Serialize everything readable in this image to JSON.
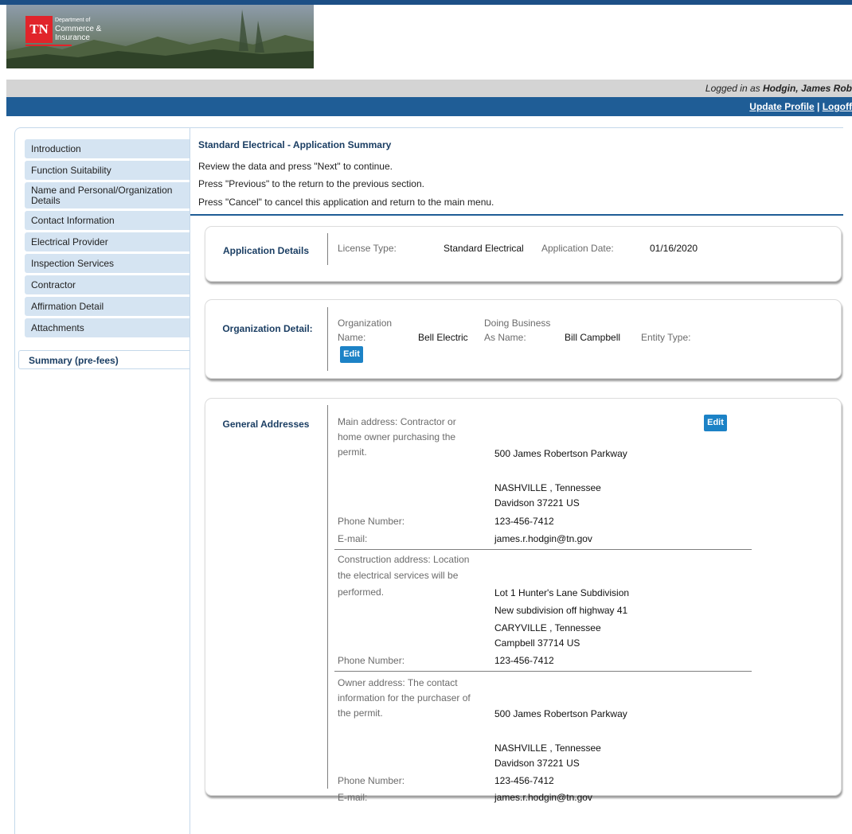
{
  "header": {
    "logo": {
      "tn": "TN",
      "line1": "Department of",
      "line2": "Commerce &",
      "line3": "Insurance"
    },
    "logged_in_prefix": "Logged in as ",
    "logged_in_user": "Hodgin, James Rob",
    "update_profile": "Update Profile",
    "separator": "|",
    "logoff": "Logoff"
  },
  "sidebar": {
    "items": [
      "Introduction",
      "Function Suitability",
      "Name and Personal/Organization Details",
      "Contact Information",
      "Electrical Provider",
      "Inspection Services",
      "Contractor",
      "Affirmation Detail",
      "Attachments"
    ],
    "active": "Summary (pre-fees)"
  },
  "main": {
    "title": "Standard Electrical - Application Summary",
    "instructions": [
      "Review the data and press \"Next\" to continue.",
      "Press \"Previous\" to the return to the previous section.",
      "Press \"Cancel\" to cancel this application and return to the main menu."
    ]
  },
  "application_details": {
    "label": "Application Details",
    "license_type_label": "License Type:",
    "license_type": "Standard Electrical",
    "application_date_label": "Application Date:",
    "application_date": "01/16/2020"
  },
  "organization_detail": {
    "label": "Organization Detail:",
    "org_name_label_1": "Organization",
    "org_name_label_2": "Name:",
    "org_name": "Bell Electric",
    "dba_label_1": "Doing Business",
    "dba_label_2": "As Name:",
    "dba_name": "Bill Campbell",
    "entity_type_label": "Entity Type:",
    "edit_label": "Edit"
  },
  "general_addresses": {
    "label": "General Addresses",
    "edit_label": "Edit",
    "main": {
      "desc": [
        "Main address: Contractor or",
        "home owner purchasing the",
        "permit."
      ],
      "line1": "500 James Robertson Parkway",
      "city": "NASHVILLE , Tennessee",
      "county_zip": "Davidson 37221 US",
      "phone_label": "Phone Number:",
      "phone": "123-456-7412",
      "email_label": "E-mail:",
      "email": "james.r.hodgin@tn.gov"
    },
    "construction": {
      "desc": [
        "Construction address: Location",
        "the electrical services will be",
        "performed."
      ],
      "line1": "Lot 1 Hunter's Lane Subdivision",
      "line2": "New subdivision off highway 41",
      "city": "CARYVILLE , Tennessee",
      "county_zip": "Campbell 37714 US",
      "phone_label": "Phone Number:",
      "phone": "123-456-7412"
    },
    "owner": {
      "desc": [
        "Owner address: The contact",
        "information for the purchaser of",
        "the permit."
      ],
      "line1": "500 James Robertson Parkway",
      "city": "NASHVILLE , Tennessee",
      "county_zip": "Davidson 37221 US",
      "phone_label": "Phone Number:",
      "phone": "123-456-7412",
      "email_label": "E-mail:",
      "email": "james.r.hodgin@tn.gov"
    }
  }
}
